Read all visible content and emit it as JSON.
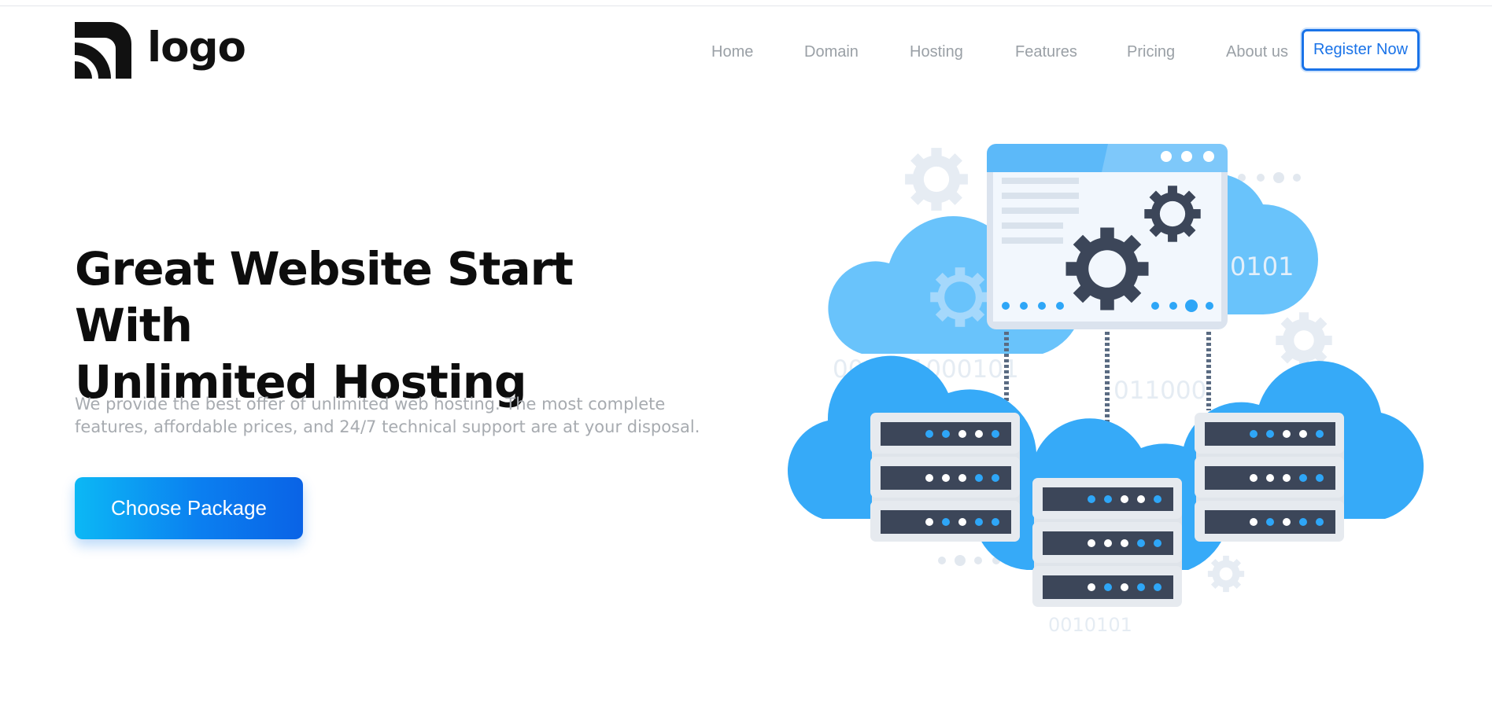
{
  "brand": {
    "logo_text": "logo",
    "accent": "#1a73e8",
    "cta_gradient": [
      "#0cb8f5",
      "#0a63e6"
    ]
  },
  "nav": {
    "items": [
      {
        "label": "Home"
      },
      {
        "label": "Domain"
      },
      {
        "label": "Hosting"
      },
      {
        "label": "Features"
      },
      {
        "label": "Pricing"
      },
      {
        "label": "About us"
      }
    ],
    "register_label": "Register Now"
  },
  "hero": {
    "title_line1": "Great Website Start With",
    "title_line2": "Unlimited Hosting",
    "subtitle_line1": "We provide the best offer of unlimited web hosting. The most complete",
    "subtitle_line2": "features, affordable prices, and 24/7 technical support are at your disposal.",
    "cta_label": "Choose Package"
  },
  "illustration": {
    "binary_1": "001011000101",
    "binary_2": "011000",
    "binary_3": "0101",
    "binary_4": "0010101",
    "icons": [
      "cloud-icon",
      "gear-icon",
      "server-icon",
      "browser-window-icon"
    ]
  }
}
